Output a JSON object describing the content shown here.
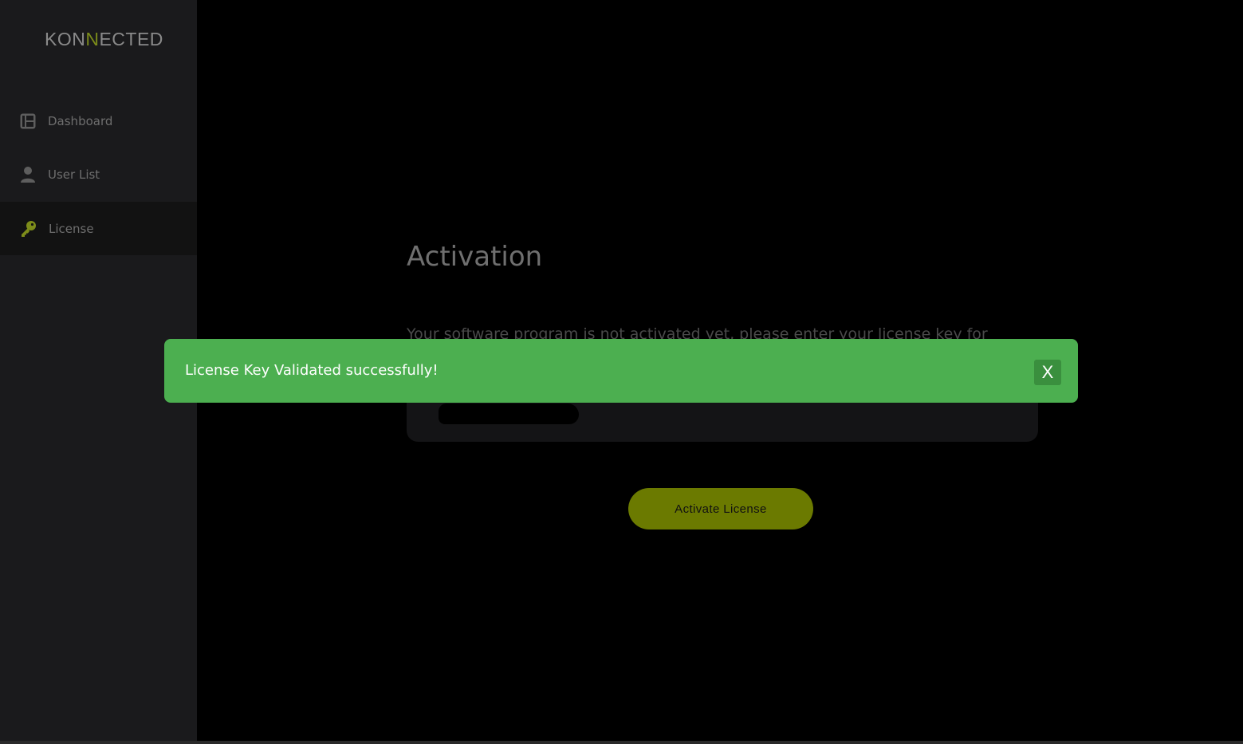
{
  "app": {
    "logo_prefix": "KON",
    "logo_accent": "N",
    "logo_suffix": "ECTED"
  },
  "sidebar": {
    "items": [
      {
        "label": "Dashboard",
        "icon": "dashboard-icon",
        "active": false
      },
      {
        "label": "User List",
        "icon": "user-icon",
        "active": false
      },
      {
        "label": "License",
        "icon": "key-icon",
        "active": true
      }
    ]
  },
  "main": {
    "title": "Activation",
    "description": "Your software program is not activated yet, please enter your license key for",
    "activate_label": "Activate License"
  },
  "toast": {
    "message": "License Key Validated successfully!",
    "close_label": "X"
  },
  "colors": {
    "accent": "#6b7a00",
    "success": "#4caf50",
    "sidebar_bg": "#1a1a1c",
    "main_bg": "#000000"
  }
}
